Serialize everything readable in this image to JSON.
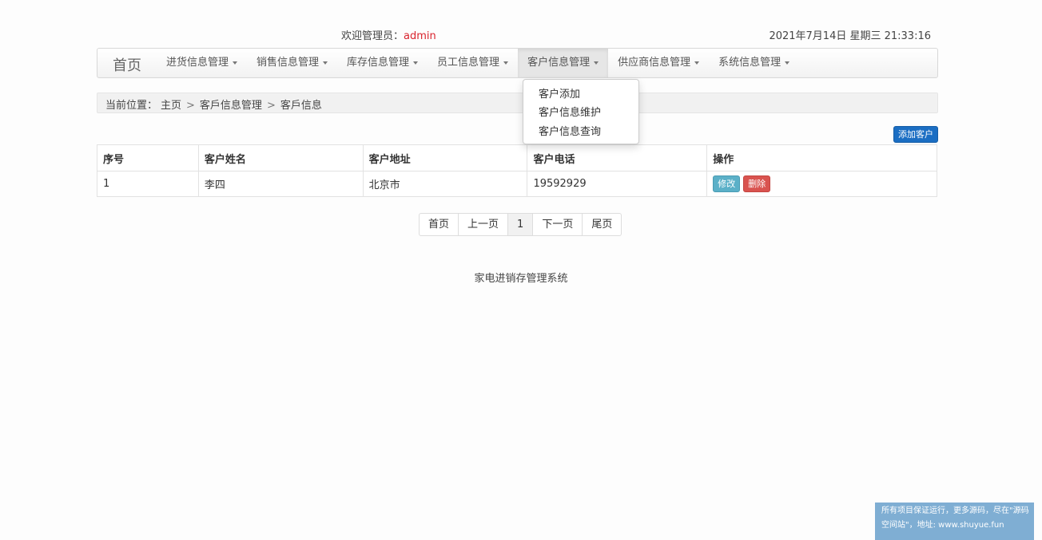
{
  "header": {
    "welcome_label": "欢迎管理员：",
    "username": "admin",
    "datetime": "2021年7月14日 星期三 21:33:16"
  },
  "navbar": {
    "brand": "首页",
    "items": [
      {
        "label": "进货信息管理"
      },
      {
        "label": "销售信息管理"
      },
      {
        "label": "库存信息管理"
      },
      {
        "label": "员工信息管理"
      },
      {
        "label": "客户信息管理"
      },
      {
        "label": "供应商信息管理"
      },
      {
        "label": "系统信息管理"
      }
    ],
    "active_index": 4
  },
  "dropdown": {
    "items": [
      "客户添加",
      "客户信息维护",
      "客户信息查询"
    ]
  },
  "breadcrumb": {
    "label": "当前位置：",
    "items": [
      "主页",
      "客戶信息管理",
      "客戶信息"
    ],
    "separator": ">"
  },
  "toolbar": {
    "add_label": "添加客户"
  },
  "table": {
    "headers": [
      "序号",
      "客户姓名",
      "客户地址",
      "客户电话",
      "操作"
    ],
    "rows": [
      {
        "id": "1",
        "name": "李四",
        "address": "北京市",
        "phone": "19592929"
      }
    ],
    "edit_label": "修改",
    "delete_label": "删除"
  },
  "pagination": {
    "first": "首页",
    "prev": "上一页",
    "current": "1",
    "next": "下一页",
    "last": "尾页"
  },
  "footer": {
    "text": "家电进销存管理系统"
  },
  "promo": {
    "line1": "所有项目保证运行，更多源码，尽在\"源码",
    "line2": "空间站\"，地址: www.shuyue.fun"
  }
}
